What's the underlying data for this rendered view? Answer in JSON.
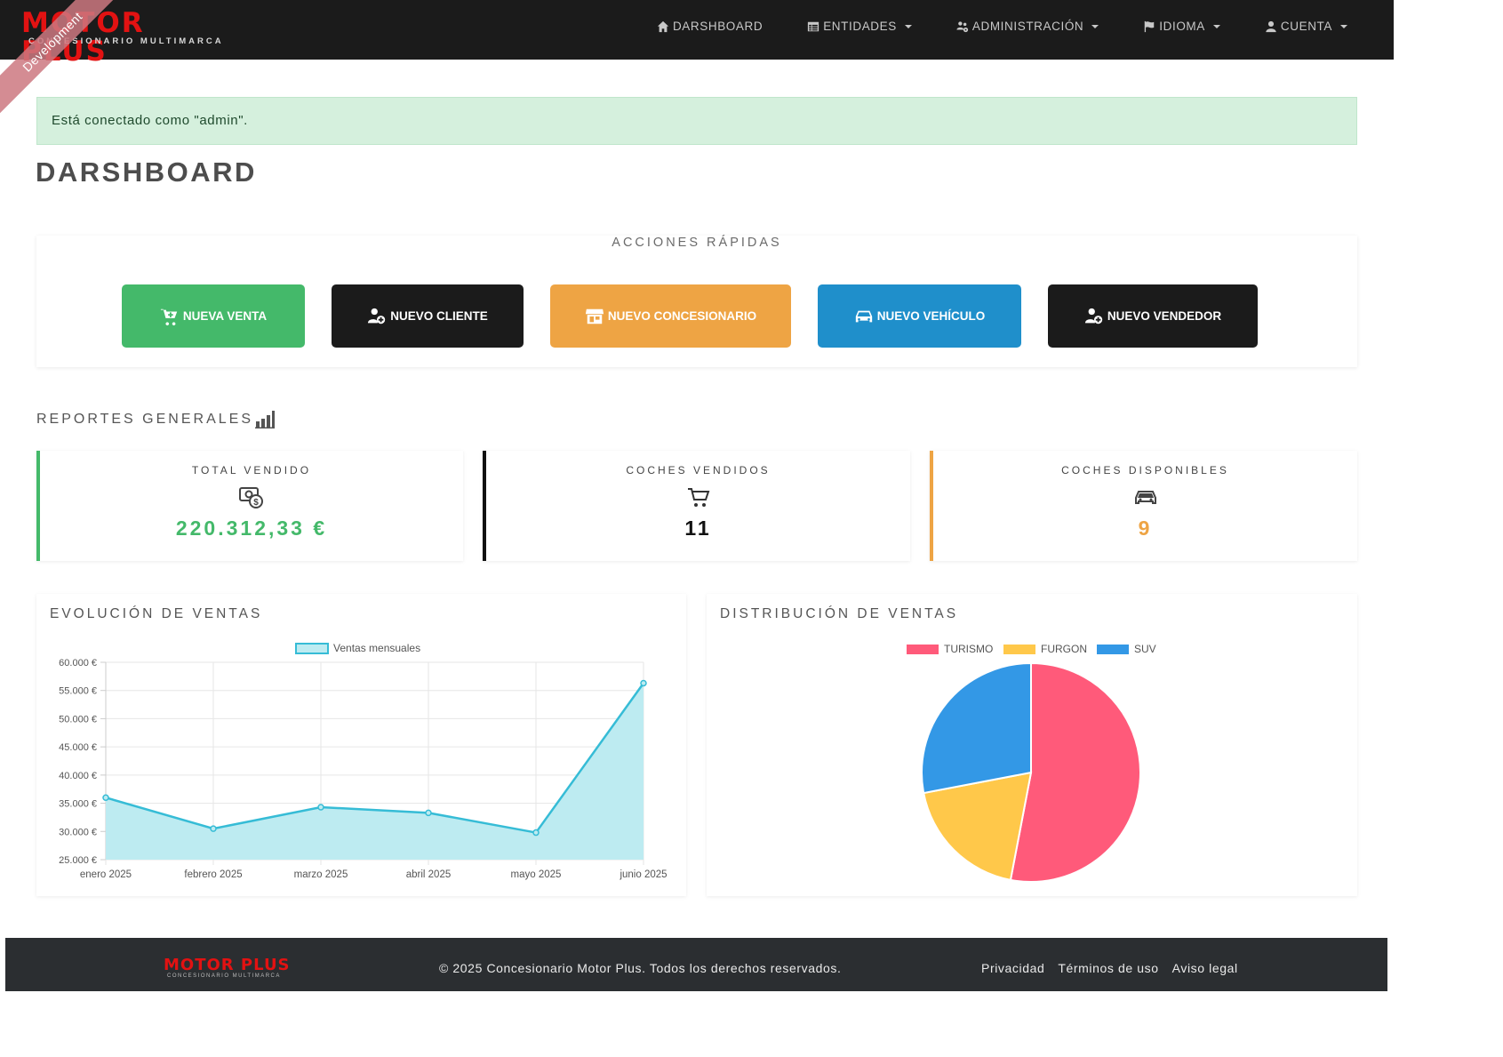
{
  "brand": {
    "name": "MOTOR PLUS",
    "subtitle": "CONCESIONARIO MULTIMARCA",
    "ribbon": "Development"
  },
  "nav": [
    {
      "label": "DARSHBOARD",
      "icon": "home-icon",
      "dropdown": false
    },
    {
      "label": "ENTIDADES",
      "icon": "table-icon",
      "dropdown": true
    },
    {
      "label": "ADMINISTRACIÓN",
      "icon": "users-cog-icon",
      "dropdown": true
    },
    {
      "label": "IDIOMA",
      "icon": "flag-icon",
      "dropdown": true
    },
    {
      "label": "CUENTA",
      "icon": "user-icon",
      "dropdown": true
    }
  ],
  "alert": "Está conectado como \"admin\".",
  "page_title": "DARSHBOARD",
  "quick_actions": {
    "title": "ACCIONES RÁPIDAS",
    "buttons": [
      {
        "label": "NUEVA VENTA",
        "icon": "cart-plus-icon",
        "color": "#44b96a"
      },
      {
        "label": "NUEVO CLIENTE",
        "icon": "user-plus-icon",
        "color": "#1b1b1b"
      },
      {
        "label": "NUEVO CONCESIONARIO",
        "icon": "store-icon",
        "color": "#eea444"
      },
      {
        "label": "NUEVO VEHÍCULO",
        "icon": "car-icon",
        "color": "#1f8fcb"
      },
      {
        "label": "NUEVO VENDEDOR",
        "icon": "user-plus-icon",
        "color": "#1b1b1b"
      }
    ]
  },
  "reports": {
    "title": "REPORTES GENERALES",
    "stats": [
      {
        "label": "TOTAL VENDIDO",
        "value": "220.312,33 €",
        "icon": "money-icon",
        "color": "#44b96a"
      },
      {
        "label": "COCHES VENDIDOS",
        "value": "11",
        "icon": "cart-icon",
        "color": "#111111"
      },
      {
        "label": "COCHES DISPONIBLES",
        "value": "9",
        "icon": "car-icon",
        "color": "#eea444"
      }
    ]
  },
  "charts": {
    "line_title": "EVOLUCIÓN DE VENTAS",
    "pie_title": "DISTRIBUCIÓN DE VENTAS"
  },
  "chart_data": [
    {
      "type": "area",
      "title": "EVOLUCIÓN DE VENTAS",
      "categories": [
        "enero 2025",
        "febrero 2025",
        "marzo 2025",
        "abril 2025",
        "mayo 2025",
        "junio 2025"
      ],
      "series": [
        {
          "name": "Ventas mensuales",
          "values": [
            36000,
            30500,
            34300,
            33300,
            29800,
            56300
          ]
        }
      ],
      "ylim": [
        25000,
        60000
      ],
      "yticks": [
        "60.000 €",
        "55.000 €",
        "50.000 €",
        "45.000 €",
        "40.000 €",
        "35.000 €",
        "30.000 €",
        "25.000 €"
      ],
      "ytick_values": [
        60000,
        55000,
        50000,
        45000,
        40000,
        35000,
        30000,
        25000
      ],
      "line_color": "#36bcd6",
      "fill_color": "#bdebf1",
      "grid": true,
      "legend": "top"
    },
    {
      "type": "pie",
      "title": "DISTRIBUCIÓN DE VENTAS",
      "categories": [
        "TURISMO",
        "FURGON",
        "SUV"
      ],
      "values": [
        53,
        19,
        28
      ],
      "colors": [
        "#ff5a7a",
        "#ffc84a",
        "#3398e6"
      ],
      "legend": "top"
    }
  ],
  "footer": {
    "brand": "MOTOR PLUS",
    "brand_sub": "CONCESIONARIO MULTIMARCA",
    "copyright": "© 2025 Concesionario Motor Plus. Todos los derechos reservados.",
    "links": [
      "Privacidad",
      "Términos de uso",
      "Aviso legal"
    ]
  }
}
